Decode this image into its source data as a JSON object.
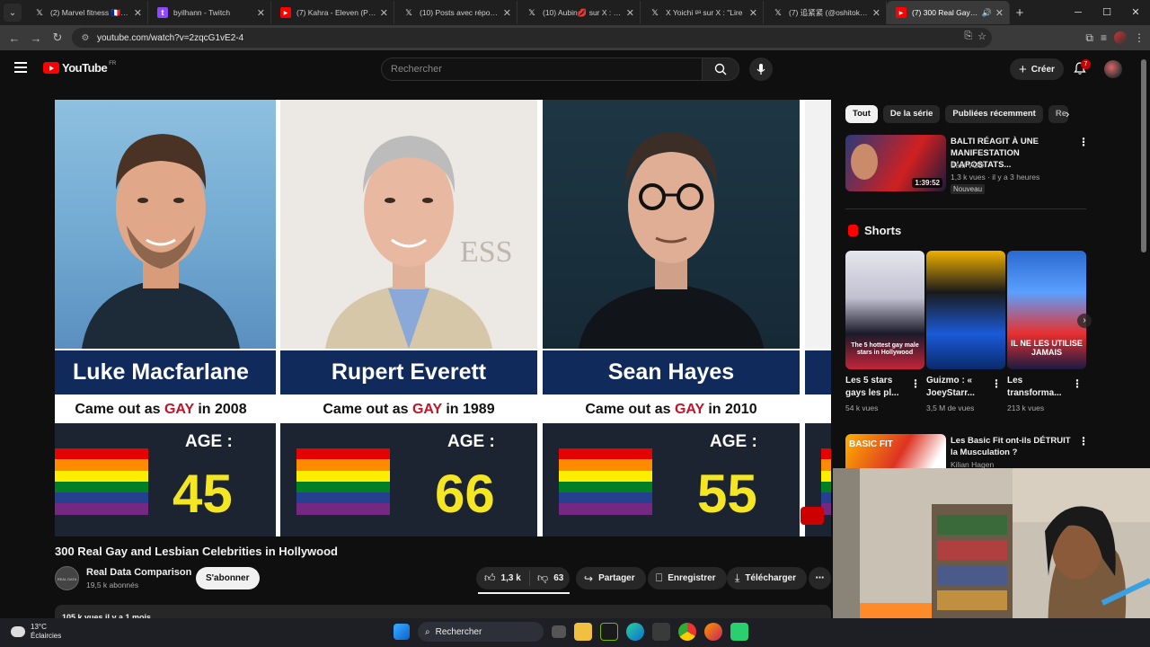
{
  "browser": {
    "tabs": [
      {
        "title": "(2) Marvel fitness 🇫🇷 (@M",
        "favicon": "x-icon",
        "active": false
      },
      {
        "title": "byilhann - Twitch",
        "favicon": "twitch-icon",
        "active": false
      },
      {
        "title": "(7) Kahra - Eleven (Prod. ",
        "favicon": "youtube-icon",
        "active": false
      },
      {
        "title": "(10) Posts avec réponses ",
        "favicon": "x-icon",
        "active": false
      },
      {
        "title": "(10) Aubin💋 sur X : \"Pou",
        "favicon": "x-icon",
        "active": false
      },
      {
        "title": "X Yoichi ᵍᵃ sur X : \"Lire ",
        "favicon": "x-icon",
        "active": false
      },
      {
        "title": "(7) 追紧紧 (@oshitokosa)",
        "favicon": "x-icon",
        "active": false
      },
      {
        "title": "(7) 300 Real Gay and",
        "favicon": "youtube-icon",
        "active": true
      }
    ],
    "url": "youtube.com/watch?v=2zqcG1vE2-4"
  },
  "yt": {
    "logo_text": "YouTube",
    "country": "FR",
    "search_placeholder": "Rechercher",
    "create_label": "Créer",
    "notif_count": "7"
  },
  "video": {
    "cards": [
      {
        "name": "Luke Macfarlane",
        "came_out_prefix": "Came out as",
        "came_out_word": "GAY",
        "came_out_suffix": "in 2008",
        "age_label": "AGE :",
        "age": "45"
      },
      {
        "name": "Rupert Everett",
        "came_out_prefix": "Came out as",
        "came_out_word": "GAY",
        "came_out_suffix": "in 1989",
        "age_label": "AGE :",
        "age": "66"
      },
      {
        "name": "Sean Hayes",
        "came_out_prefix": "Came out as",
        "came_out_word": "GAY",
        "came_out_suffix": "in 2010",
        "age_label": "AGE :",
        "age": "55"
      }
    ],
    "title": "300 Real Gay and Lesbian Celebrities in Hollywood",
    "channel": {
      "name": "Real Data Comparison",
      "subs": "19,5 k abonnés",
      "avatar_text": "REAL DATA COMPARISON"
    },
    "subscribe_label": "S'abonner",
    "likes": "1,3 k",
    "dislikes": "63",
    "share_label": "Partager",
    "save_label": "Enregistrer",
    "download_label": "Télécharger",
    "desc_meta": "105 k vues  il y a 1 mois"
  },
  "sidebar": {
    "chips": [
      "Tout",
      "De la série",
      "Publiées récemment",
      "Re"
    ],
    "reco1": {
      "title": "BALTI RÉAGIT À UNE MANIFESTATION D'APOSTATS...",
      "channel": "Balti VOD",
      "meta": "1,3 k vues · il y a 3 heures",
      "badge": "Nouveau",
      "duration": "1:39:52"
    },
    "shorts_label": "Shorts",
    "shorts": [
      {
        "title": "Les 5 stars gays les pl...",
        "views": "54 k vues",
        "caption": "The 5 hottest gay male stars in Hollywood"
      },
      {
        "title": "Guizmo : « JoeyStarr...",
        "views": "3,5 M de vues",
        "caption": ""
      },
      {
        "title": "Les transforma...",
        "views": "213 k vues",
        "caption": "IL NE LES UTILISE JAMAIS"
      }
    ],
    "reco2": {
      "title": "Les Basic Fit ont-ils DÉTRUIT la Musculation ?",
      "channel": "Kilian Hagen",
      "thumb_text": "BASIC FIT"
    }
  },
  "taskbar": {
    "temp": "13°C",
    "weather": "Éclaircies",
    "search_label": "Rechercher"
  }
}
